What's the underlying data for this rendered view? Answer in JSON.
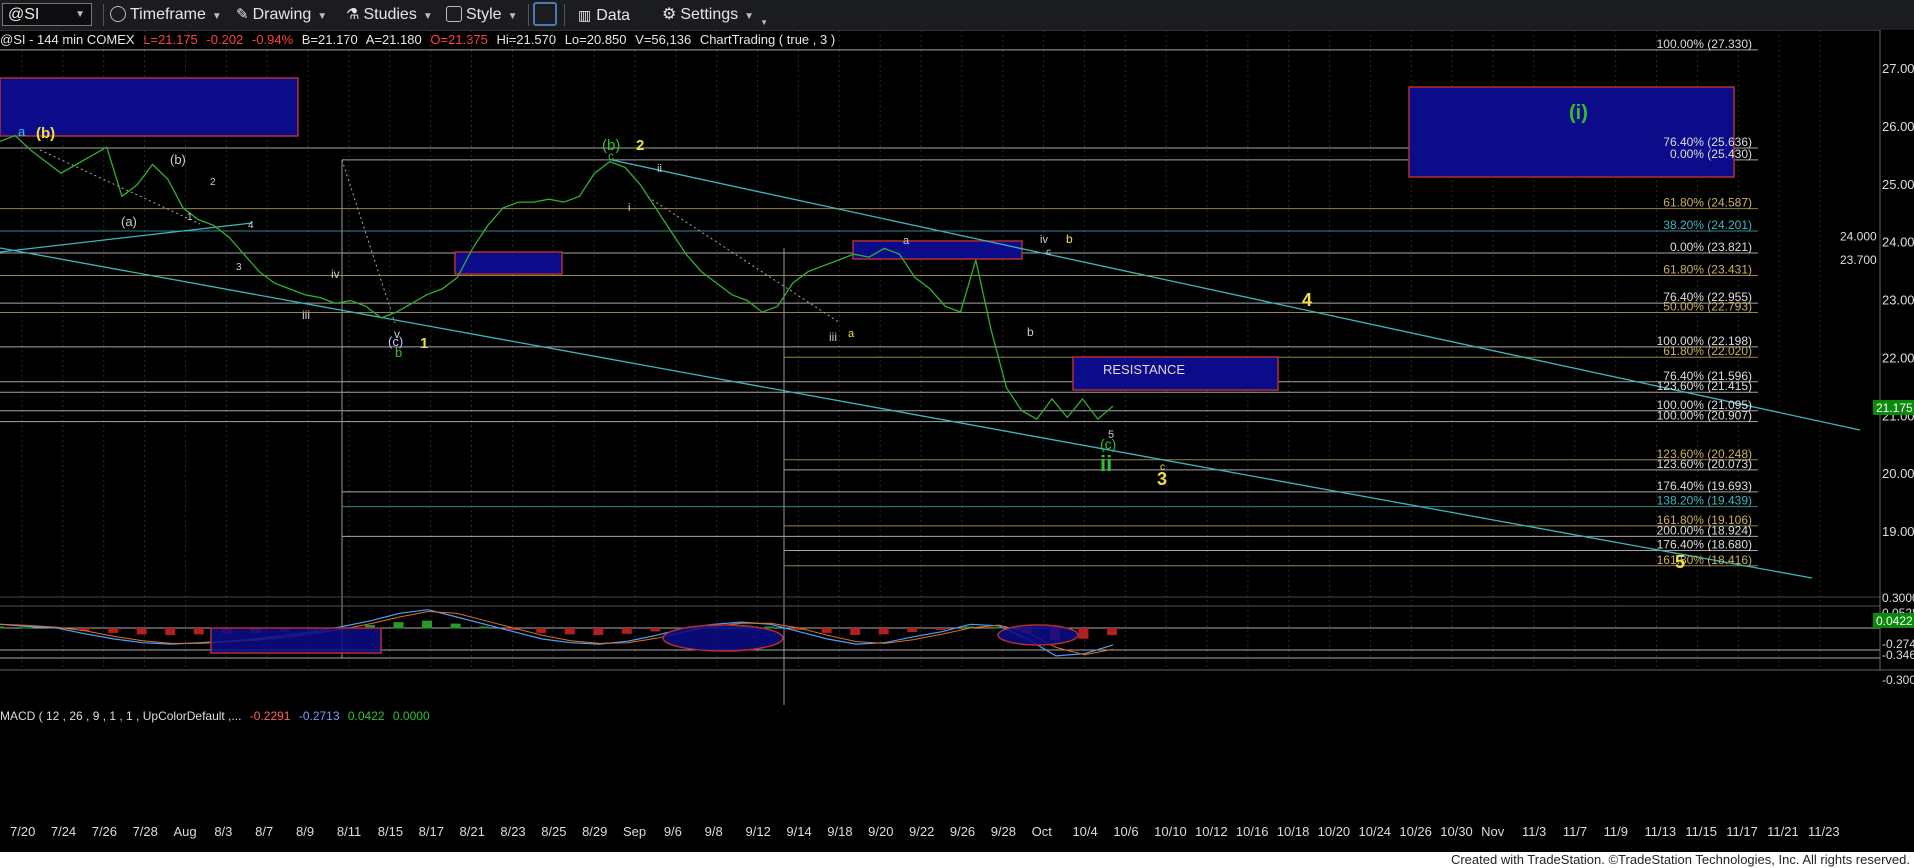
{
  "toolbar": {
    "symbol": "@SI",
    "timeframe_label": "Timeframe",
    "drawing_label": "Drawing",
    "studies_label": "Studies",
    "style_label": "Style",
    "data_label": "Data",
    "settings_label": "Settings"
  },
  "header": {
    "symbol_info": "@SI - 144 min  COMEX",
    "last": "L=21.175",
    "change": "-0.202",
    "change_pct": "-0.94%",
    "bid": "B=21.170",
    "ask": "A=21.180",
    "open": "O=21.375",
    "high": "Hi=21.570",
    "low": "Lo=20.850",
    "volume": "V=56,136",
    "study": "ChartTrading ( true , 3 )"
  },
  "macd_header": {
    "name": "MACD ( 12 , 26 , 9 , 1 , 1 , UpColorDefault ,...",
    "macd": "-0.2291",
    "avg": "-0.2713",
    "diff": "0.0422",
    "zero": "0.0000"
  },
  "price_axis": [
    "27.000",
    "26.000",
    "25.000",
    "24.000",
    "23.000",
    "22.000",
    "21.000",
    "20.000",
    "19.000"
  ],
  "price_axis_extra": [
    "24.000",
    "23.700"
  ],
  "last_price_tag": "21.175",
  "macd_axis": [
    "0.3000",
    "0.0528",
    "-0.2742",
    "-0.3461",
    "-0.3000"
  ],
  "macd_last_tag": "0.0422",
  "date_axis": [
    "7/20",
    "7/24",
    "7/26",
    "7/28",
    "Aug",
    "8/3",
    "8/7",
    "8/9",
    "8/11",
    "8/15",
    "8/17",
    "8/21",
    "8/23",
    "8/25",
    "8/29",
    "Sep",
    "9/6",
    "9/8",
    "9/12",
    "9/14",
    "9/18",
    "9/20",
    "9/22",
    "9/26",
    "9/28",
    "Oct",
    "10/4",
    "10/6",
    "10/10",
    "10/12",
    "10/16",
    "10/18",
    "10/20",
    "10/24",
    "10/26",
    "10/30",
    "Nov",
    "11/3",
    "11/7",
    "11/9",
    "11/13",
    "11/15",
    "11/17",
    "11/21",
    "11/23"
  ],
  "fib_labels": [
    "100.00% (27.330)",
    "76.40% (25.636)",
    "0.00% (25.430)",
    "61.80% (24.587)",
    "38.20% (24.201)",
    "0.00% (23.821)",
    "61.80% (23.431)",
    "76.40% (22.955)",
    "50.00% (22.793)",
    "100.00% (22.198)",
    "61.80% (22.020)",
    "76.40% (21.596)",
    "123.60% (21.415)",
    "100.00% (21.095)",
    "100.00% (20.907)",
    "123.60% (20.248)",
    "123.60% (20.073)",
    "176.40% (19.693)",
    "138.20% (19.439)",
    "161.80% (19.106)",
    "200.00% (18.924)",
    "176.40% (18.680)",
    "161.80% (18.416)"
  ],
  "wave_labels": {
    "a_top": "a",
    "b_paren": "(b)",
    "a_paren": "(a)",
    "b_paren2": "(b)",
    "two_small": "2",
    "one_small": "1",
    "four_small": "4",
    "three_small": "3",
    "iii_1": "iii",
    "iv_1": "iv",
    "v_1": "v",
    "c_paren": "(c)",
    "b_green": "b",
    "one_yellow": "1",
    "b_paren_green": "(b)",
    "c_small": "c",
    "two_yellow": "2",
    "ii_small": "ii",
    "i_small": "i",
    "iii_2": "iii",
    "a_yellow": "a",
    "a_small": "a",
    "b_small": "b",
    "iv_2": "iv",
    "b_yellow": "b",
    "c_small2": "c",
    "five_small": "5",
    "c_paren_green": "(c)",
    "ii_green": "ii",
    "c_small3": "c",
    "three_yellow": "3",
    "four_yellow": "4",
    "five_yellow": "5",
    "i_paren_green": "(i)",
    "resistance": "RESISTANCE"
  },
  "footer": "Created with TradeStation. ©TradeStation Technologies, Inc. All rights reserved.",
  "chart_data": {
    "type": "line",
    "title": "@SI - 144 min COMEX",
    "ylim": [
      18.3,
      27.4
    ],
    "series": [
      {
        "values": [
          25.75,
          25.85,
          25.6,
          25.4,
          25.2,
          25.35,
          25.5,
          25.65,
          24.8,
          25.0,
          25.35,
          25.1,
          24.6,
          24.4,
          24.3,
          24.1,
          23.8,
          23.5,
          23.3,
          23.2,
          23.1,
          23.05,
          22.95,
          23.0,
          22.9,
          22.7,
          22.8,
          22.95,
          23.1,
          23.2,
          23.4,
          23.9,
          24.3,
          24.6,
          24.7,
          24.7,
          24.75,
          24.7,
          24.8,
          25.2,
          25.4,
          25.3,
          25.0,
          24.6,
          24.2,
          23.8,
          23.5,
          23.3,
          23.1,
          23.0,
          22.8,
          22.9,
          23.3,
          23.5,
          23.6,
          23.7,
          23.8,
          23.75,
          23.9,
          23.8,
          23.4,
          23.2,
          22.9,
          22.8,
          23.7,
          22.5,
          21.5,
          21.1,
          20.95,
          21.3,
          20.98,
          21.3,
          20.95,
          21.175
        ]
      }
    ],
    "macd": {
      "values": [
        0.05,
        0.02,
        0.0,
        -0.08,
        -0.15,
        -0.2,
        -0.22,
        -0.2,
        -0.18,
        -0.15,
        -0.1,
        -0.05,
        0.02,
        0.1,
        0.2,
        0.25,
        0.15,
        0.05,
        -0.05,
        -0.15,
        -0.2,
        -0.22,
        -0.18,
        -0.1,
        0.0,
        0.05,
        0.08,
        0.05,
        -0.05,
        -0.15,
        -0.22,
        -0.2,
        -0.12,
        -0.05,
        0.05,
        0.03,
        -0.15,
        -0.38,
        -0.35,
        -0.23
      ],
      "ylim": [
        -0.42,
        0.36
      ]
    }
  }
}
